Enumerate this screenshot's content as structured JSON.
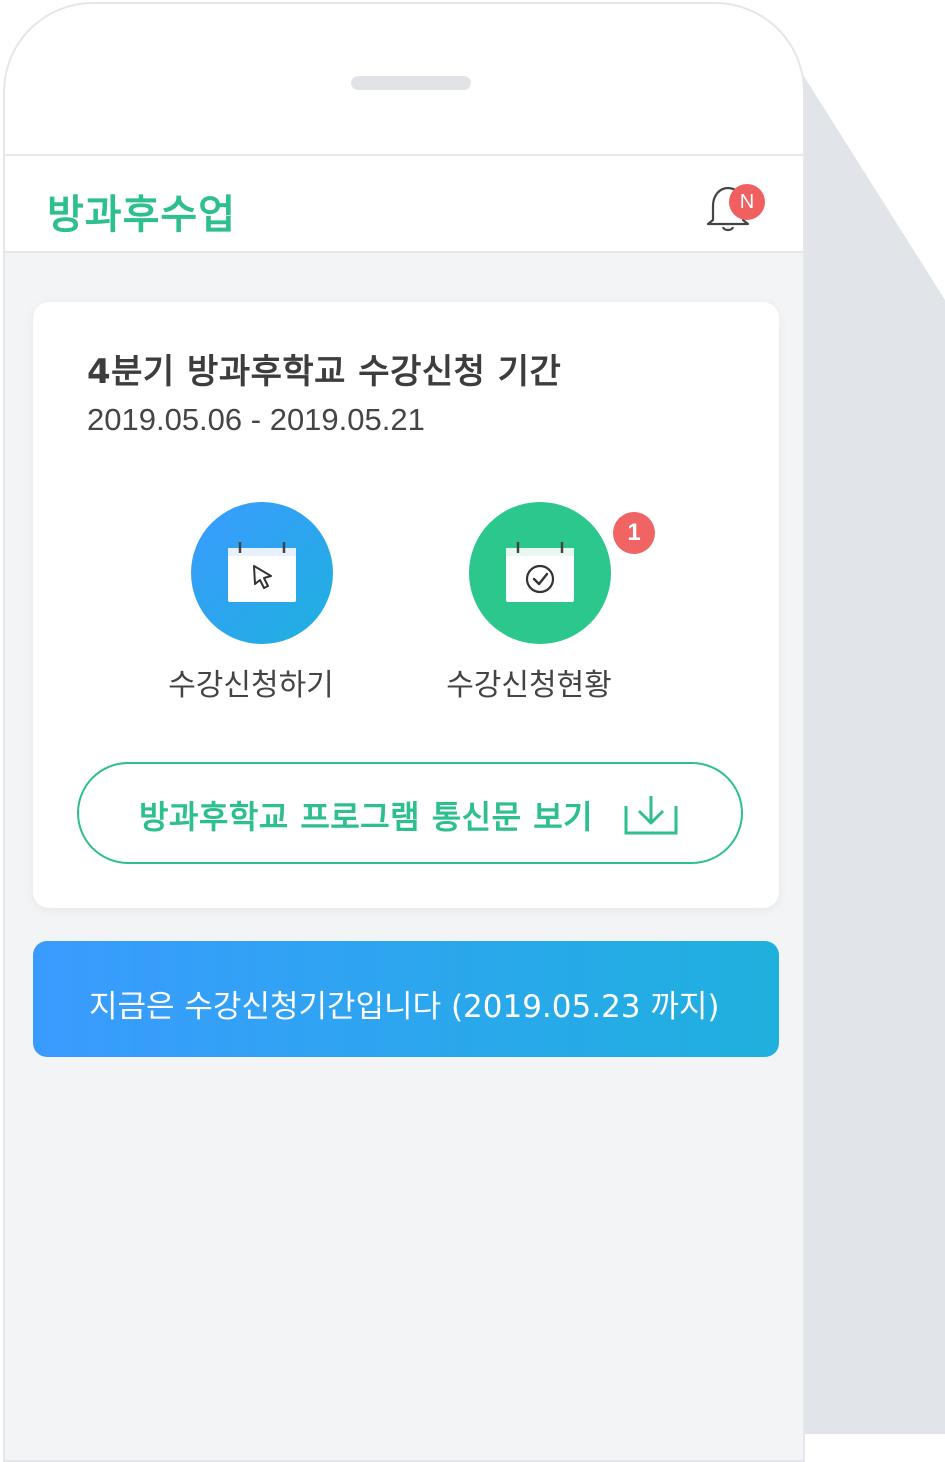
{
  "app": {
    "title": "방과후수업"
  },
  "notifications": {
    "badge": "N"
  },
  "card": {
    "title": "4분기 방과후학교 수강신청 기간",
    "period": "2019.05.06 - 2019.05.21",
    "actions": [
      {
        "label": "수강신청하기",
        "icon": "calendar-cursor-icon"
      },
      {
        "label": "수강신청현황",
        "icon": "calendar-check-icon",
        "badge": "1"
      }
    ],
    "download_button": {
      "label": "방과후학교 프로그램 통신문 보기",
      "icon": "download-icon"
    }
  },
  "notice": {
    "text": "지금은 수강신청기간입니다 (2019.05.23 까지)"
  },
  "colors": {
    "brand_green": "#2dbf8d",
    "brand_blue": "#3a9bff",
    "badge_red": "#f06060"
  }
}
